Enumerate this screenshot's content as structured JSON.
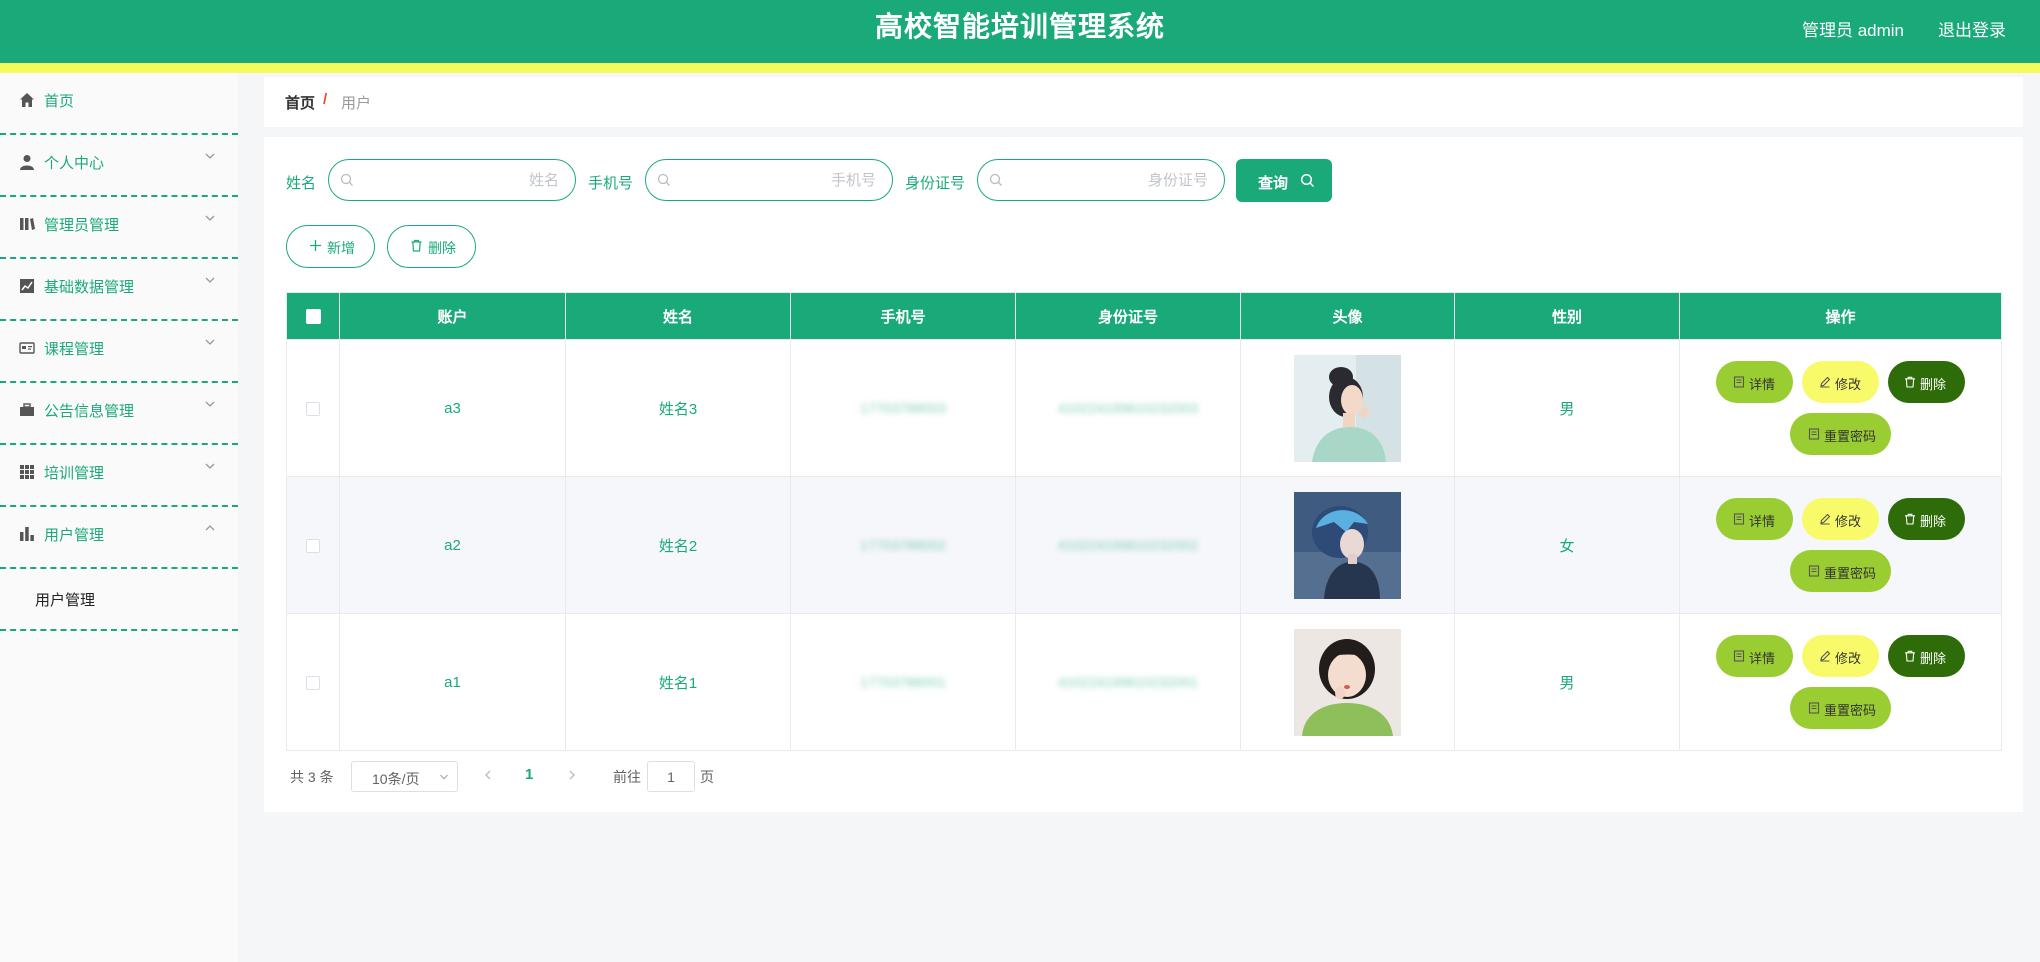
{
  "header": {
    "title": "高校智能培训管理系统",
    "user": "管理员 admin",
    "logout": "退出登录"
  },
  "sidebar": {
    "items": [
      {
        "label": "首页",
        "icon": "home-icon"
      },
      {
        "label": "个人中心",
        "icon": "user-icon"
      },
      {
        "label": "管理员管理",
        "icon": "book-icon"
      },
      {
        "label": "基础数据管理",
        "icon": "chart-icon"
      },
      {
        "label": "课程管理",
        "icon": "card-icon"
      },
      {
        "label": "公告信息管理",
        "icon": "briefcase-icon"
      },
      {
        "label": "培训管理",
        "icon": "grid-icon"
      },
      {
        "label": "用户管理",
        "icon": "bar-icon"
      }
    ],
    "sub_item": "用户管理"
  },
  "breadcrumb": {
    "home": "首页",
    "sep": "/",
    "current": "用户"
  },
  "search": {
    "name_label": "姓名",
    "name_placeholder": "姓名",
    "phone_label": "手机号",
    "phone_placeholder": "手机号",
    "idcard_label": "身份证号",
    "idcard_placeholder": "身份证号",
    "query": "查询"
  },
  "actions": {
    "add": "新增",
    "delete": "删除"
  },
  "table": {
    "headers": [
      "账户",
      "姓名",
      "手机号",
      "身份证号",
      "头像",
      "性别",
      "操作"
    ],
    "rows": [
      {
        "account": "a3",
        "name": "姓名3",
        "phone": "17703788003",
        "idcard": "410224199610232003",
        "gender": "男"
      },
      {
        "account": "a2",
        "name": "姓名2",
        "phone": "17703788002",
        "idcard": "410224199610232002",
        "gender": "女"
      },
      {
        "account": "a1",
        "name": "姓名1",
        "phone": "17703788001",
        "idcard": "410224199610232001",
        "gender": "男"
      }
    ],
    "ops": {
      "detail": "详情",
      "edit": "修改",
      "delete": "删除",
      "reset": "重置密码"
    }
  },
  "pagination": {
    "total": "共 3 条",
    "page_size": "10条/页",
    "current": "1",
    "goto": "前往",
    "goto_value": "1",
    "page": "页"
  },
  "colors": {
    "primary": "#1aaa79",
    "accent_strip": "#f4fb5a",
    "detail": "#9acd32",
    "edit": "#f8fa6a",
    "danger": "#2e6b09"
  }
}
